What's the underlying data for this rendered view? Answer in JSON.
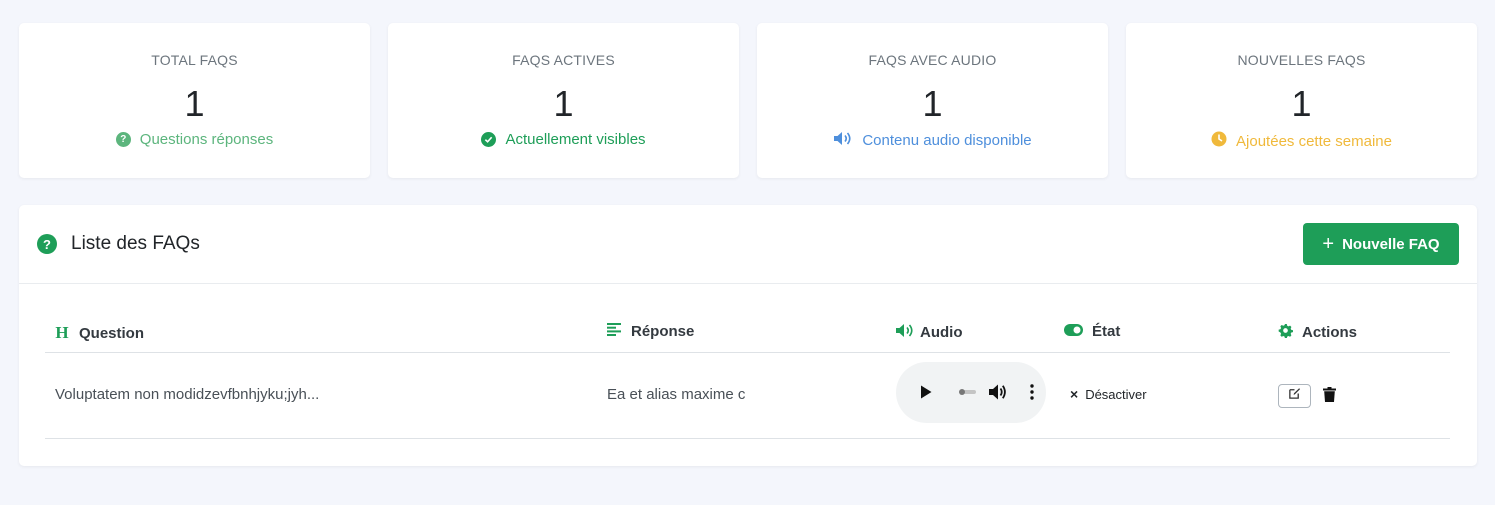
{
  "stats": [
    {
      "title": "TOTAL FAQS",
      "value": "1",
      "subtitle": "Questions réponses",
      "icon": "question-circle-icon",
      "color": "#5cb57d"
    },
    {
      "title": "FAQS ACTIVES",
      "value": "1",
      "subtitle": "Actuellement visibles",
      "icon": "check-circle-icon",
      "color": "#1e9e58"
    },
    {
      "title": "FAQS AVEC AUDIO",
      "value": "1",
      "subtitle": "Contenu audio disponible",
      "icon": "volume-icon",
      "color": "#4e8fdc"
    },
    {
      "title": "NOUVELLES FAQS",
      "value": "1",
      "subtitle": "Ajoutées cette semaine",
      "icon": "clock-icon",
      "color": "#f0b93b"
    }
  ],
  "panel": {
    "title": "Liste des FAQs",
    "new_button": "Nouvelle FAQ",
    "accent": "#1e9e58"
  },
  "table": {
    "headers": [
      {
        "label": "Question",
        "icon": "heading-icon"
      },
      {
        "label": "Réponse",
        "icon": "align-left-icon"
      },
      {
        "label": "Audio",
        "icon": "volume-icon"
      },
      {
        "label": "État",
        "icon": "toggle-icon"
      },
      {
        "label": "Actions",
        "icon": "gear-icon"
      }
    ],
    "rows": [
      {
        "question": "Voluptatem non modidzevfbnhjyku;jyh...",
        "reponse": "Ea et alias maxime c",
        "state_action": "Désactiver"
      }
    ]
  }
}
